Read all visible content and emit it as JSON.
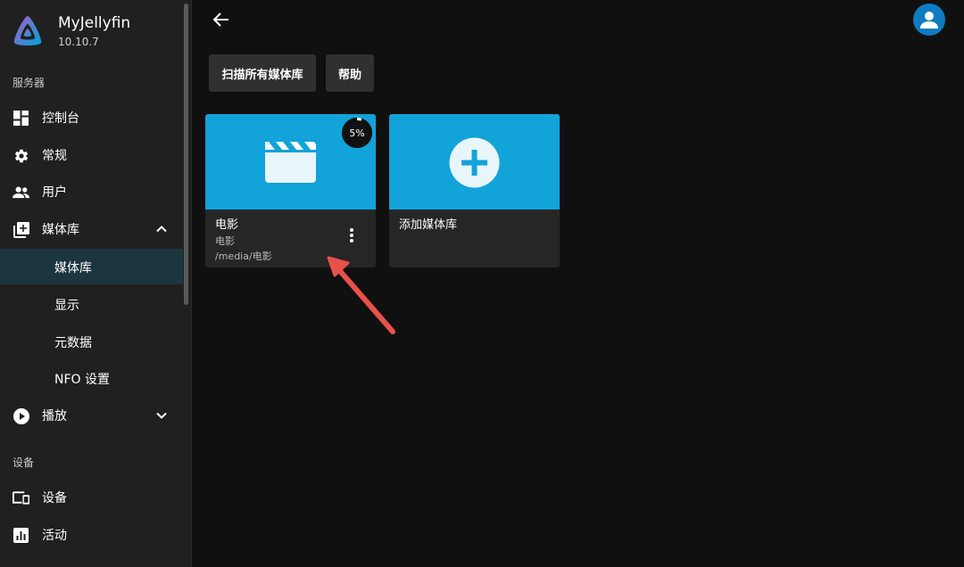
{
  "app": {
    "name": "MyJellyfin",
    "version": "10.10.7"
  },
  "sidebar": {
    "server_header": "服务器",
    "items": [
      {
        "label": "控制台",
        "icon": "dashboard-icon"
      },
      {
        "label": "常规",
        "icon": "gear-icon"
      },
      {
        "label": "用户",
        "icon": "people-icon"
      },
      {
        "label": "媒体库",
        "icon": "library-add-icon",
        "expanded": true
      }
    ],
    "library_sub": [
      {
        "label": "媒体库",
        "active": true
      },
      {
        "label": "显示",
        "active": false
      },
      {
        "label": "元数据",
        "active": false
      },
      {
        "label": "NFO 设置",
        "active": false
      }
    ],
    "playback": {
      "label": "播放",
      "icon": "play-circle-icon",
      "expanded": false
    },
    "devices_header": "设备",
    "devices_items": [
      {
        "label": "设备",
        "icon": "devices-icon"
      },
      {
        "label": "活动",
        "icon": "activity-chart-icon"
      }
    ]
  },
  "toolbar": {
    "scan_label": "扫描所有媒体库",
    "help_label": "帮助"
  },
  "libraries": [
    {
      "title": "电影",
      "type": "电影",
      "path": "/media/电影",
      "progress_text": "5%",
      "progress": 0.05,
      "icon": "clapperboard-icon"
    }
  ],
  "add_library": {
    "label": "添加媒体库",
    "icon": "plus-circle-icon"
  },
  "colors": {
    "accent": "#12a3d9",
    "sidebar_bg": "#202020",
    "active_item": "#1c3640",
    "page_bg": "#101010",
    "annotation_arrow": "#e8524a",
    "user_avatar": "#0d7cc0"
  }
}
